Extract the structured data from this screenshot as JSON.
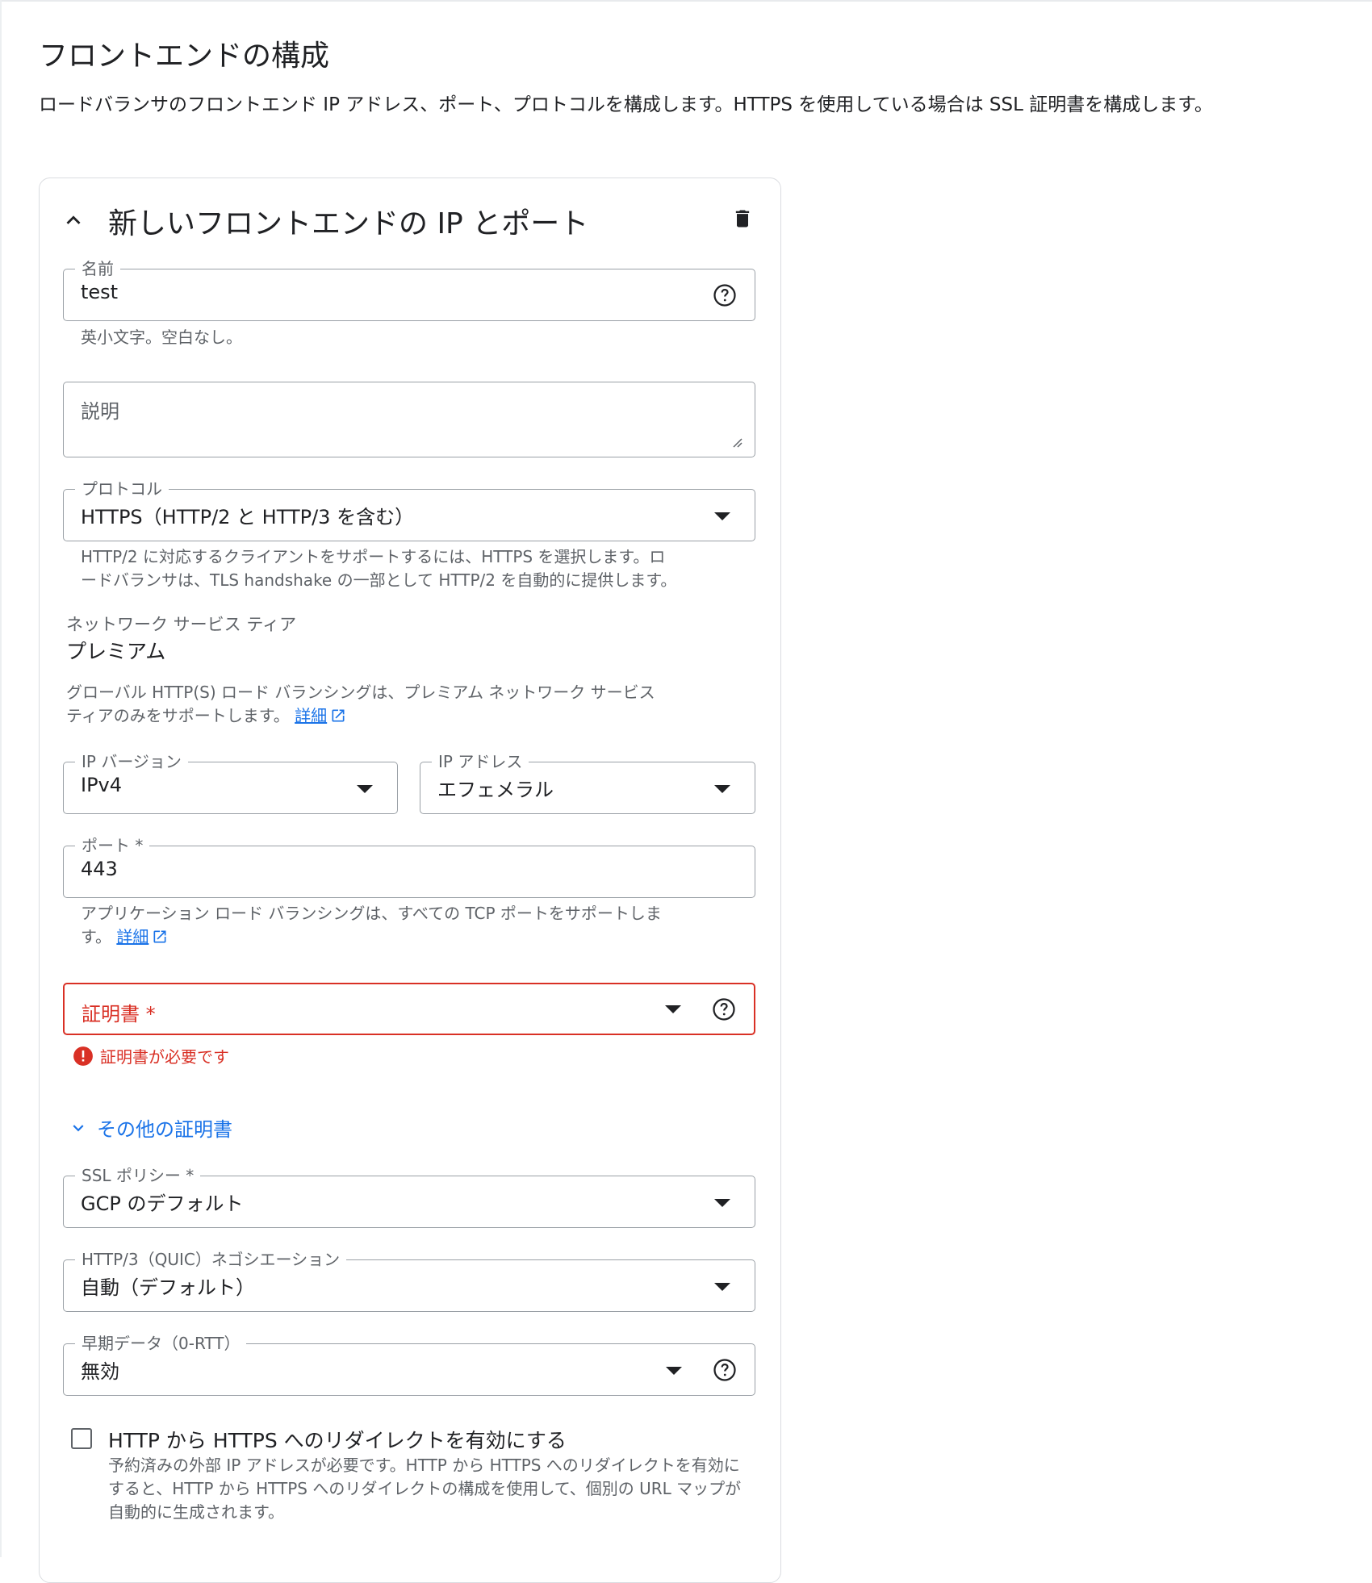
{
  "page": {
    "title": "フロントエンドの構成",
    "description": "ロードバランサのフロントエンド IP アドレス、ポート、プロトコルを構成します。HTTPS を使用している場合は SSL 証明書を構成します。"
  },
  "card": {
    "title": "新しいフロントエンドの IP とポート"
  },
  "name_field": {
    "label": "名前",
    "value": "test",
    "hint": "英小文字。空白なし。"
  },
  "description_field": {
    "placeholder": "説明"
  },
  "protocol_field": {
    "label": "プロトコル",
    "value": "HTTPS（HTTP/2 と HTTP/3 を含む）",
    "hint_line1": "HTTP/2 に対応するクライアントをサポートするには、HTTPS を選択します。ロ",
    "hint_line2": "ードバランサは、TLS handshake の一部として HTTP/2 を自動的に提供します。"
  },
  "network_tier": {
    "label": "ネットワーク サービス ティア",
    "value": "プレミアム",
    "note_line1": "グローバル HTTP(S) ロード バランシングは、プレミアム ネットワーク サービス",
    "note_line2": "ティアのみをサポートします。",
    "link": "詳細"
  },
  "ip_version_field": {
    "label": "IP バージョン",
    "value": "IPv4"
  },
  "ip_address_field": {
    "label": "IP アドレス",
    "value": "エフェメラル"
  },
  "port_field": {
    "label": "ポート *",
    "value": "443",
    "hint_line1": "アプリケーション ロード バランシングは、すべての TCP ポートをサポートしま",
    "hint_line2": "す。",
    "link": "詳細"
  },
  "certificate_field": {
    "label": "証明書 *",
    "error": "証明書が必要です"
  },
  "more_certificates": {
    "label": "その他の証明書"
  },
  "ssl_policy_field": {
    "label": "SSL ポリシー *",
    "value": "GCP のデフォルト"
  },
  "quic_field": {
    "label": "HTTP/3（QUIC）ネゴシエーション",
    "value": "自動（デフォルト）"
  },
  "early_data_field": {
    "label": "早期データ（0-RTT）",
    "value": "無効"
  },
  "redirect_checkbox": {
    "label": "HTTP から HTTPS へのリダイレクトを有効にする",
    "description": "予約済みの外部 IP アドレスが必要です。HTTP から HTTPS へのリダイレクトを有効にすると、HTTP から HTTPS へのリダイレクトの構成を使用して、個別の URL マップが自動的に生成されます。",
    "checked": false
  },
  "colors": {
    "accent": "#1a73e8",
    "error": "#d93025",
    "border": "#9aa0a6",
    "text": "#202124",
    "secondary_text": "#5f6368"
  }
}
